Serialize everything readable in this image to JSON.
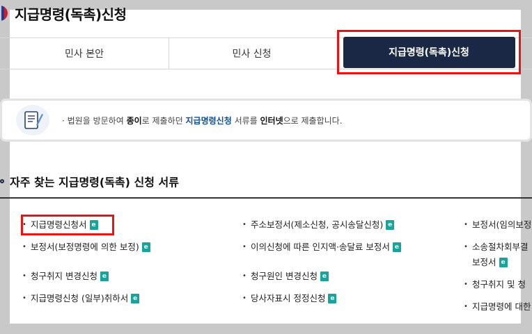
{
  "header": {
    "title": "지급명령(독촉)신청"
  },
  "tabs": [
    {
      "label": "민사 본안"
    },
    {
      "label": "민사 신청"
    },
    {
      "label": "지급명령(독촉)신청",
      "active": true
    }
  ],
  "notice": {
    "prefix": "법원을 방문하여 ",
    "paper": "종이",
    "mid": "로 제출하던 ",
    "app": "지급명령신청",
    "mid2": " 서류를 ",
    "internet": "인터넷",
    "suffix": "으로 제출합니다."
  },
  "section": {
    "title": "자주 찾는 지급명령(독촉) 신청 서류"
  },
  "documents": {
    "col1": [
      "지급명령신청서",
      "보정서(보정명령에 의한 보정)",
      "청구취지 변경신청",
      "지급명령신청 (일부)취하서"
    ],
    "col2": [
      "주소보정서(제소신청, 공시송달신청)",
      "이의신청에 따른 인지액·송달료 보정서",
      "청구원인 변경신청",
      "당사자표시 정정신청"
    ],
    "col3": [
      "보정서(임의보정",
      "소송절차회부결",
      "보정서",
      "청구취지 및 청",
      "지급명령에 대한"
    ]
  },
  "icons": {
    "doc": "e-form-icon",
    "notice": "document-quill-icon"
  },
  "colors": {
    "active_tab": "#1b2845",
    "highlight": "#ee1111",
    "accent_blue": "#0b4f9e"
  }
}
